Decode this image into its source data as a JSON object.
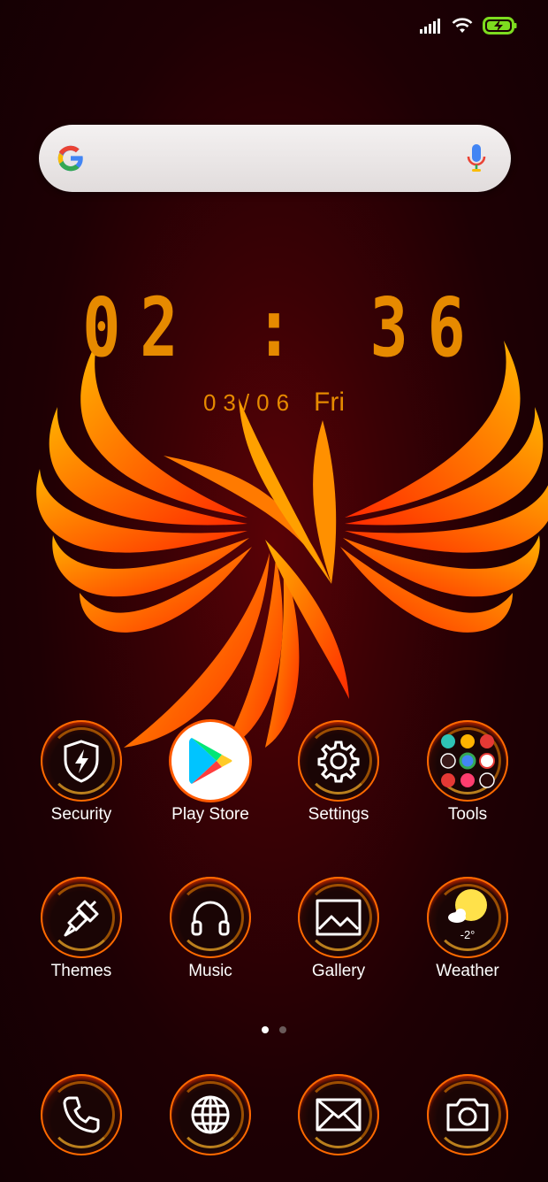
{
  "status_bar": {
    "icons": [
      "signal-icon",
      "wifi-icon",
      "battery-charging-icon"
    ],
    "battery_color": "#7ddc1f"
  },
  "search": {
    "logo": "google-g-icon",
    "mic": "microphone-icon"
  },
  "clock": {
    "time": "02:36",
    "date": "03/06",
    "weekday": "Fri",
    "color": "#e68a00"
  },
  "apps_row1": [
    {
      "label": "Security",
      "icon": "shield-bolt-icon"
    },
    {
      "label": "Play Store",
      "icon": "play-store-icon"
    },
    {
      "label": "Settings",
      "icon": "gear-icon"
    },
    {
      "label": "Tools",
      "icon": "folder-icon"
    }
  ],
  "apps_row2": [
    {
      "label": "Themes",
      "icon": "paintbrush-icon"
    },
    {
      "label": "Music",
      "icon": "headphones-icon"
    },
    {
      "label": "Gallery",
      "icon": "image-icon"
    },
    {
      "label": "Weather",
      "icon": "sun-cloud-icon",
      "temp": "-2°"
    }
  ],
  "dock": [
    {
      "icon": "phone-icon"
    },
    {
      "icon": "globe-icon"
    },
    {
      "icon": "mail-icon"
    },
    {
      "icon": "camera-icon"
    }
  ],
  "pager": {
    "pages": 2,
    "current": 1
  },
  "wallpaper": {
    "accent": "#ff6a00",
    "bg": "#1e0004"
  }
}
